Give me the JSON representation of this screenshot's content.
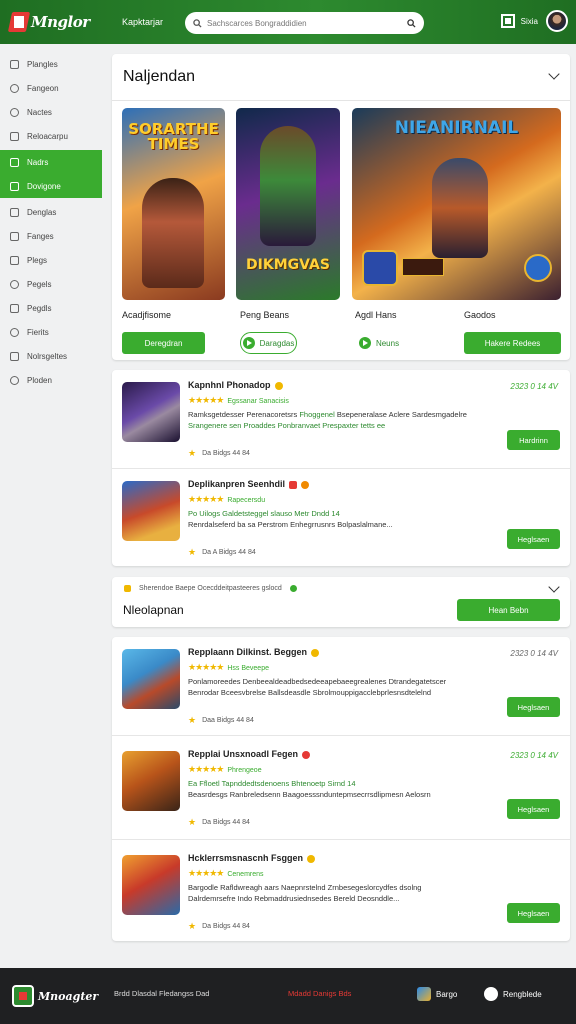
{
  "header": {
    "logo": "Mnglor",
    "nav_link": "Kapktarjar",
    "search_placeholder": "Sachscarces Bongraddidien",
    "user_name": "Sixia"
  },
  "sidebar": {
    "items": [
      {
        "label": "Plangles",
        "icon": "grid-icon"
      },
      {
        "label": "Fangeon",
        "icon": "gamepad-icon"
      },
      {
        "label": "Nactes",
        "icon": "clock-icon"
      },
      {
        "label": "Reloacarpu",
        "icon": "download-icon"
      },
      {
        "label": "Nadrs",
        "icon": "fire-icon",
        "active": true
      },
      {
        "label": "Dovigone",
        "icon": "star-icon",
        "active": true
      },
      {
        "label": "Denglas",
        "icon": "copy-icon"
      },
      {
        "label": "Fanges",
        "icon": "gift-icon"
      },
      {
        "label": "Plegs",
        "icon": "chart-icon"
      },
      {
        "label": "Pegels",
        "icon": "wrench-icon"
      },
      {
        "label": "Pegdls",
        "icon": "document-icon"
      },
      {
        "label": "Fierits",
        "icon": "tools-icon"
      },
      {
        "label": "Nolrsgeltes",
        "icon": "mail-icon"
      },
      {
        "label": "Ploden",
        "icon": "settings-icon"
      }
    ]
  },
  "hero": {
    "title": "Naljendan",
    "games": [
      {
        "poster_title": "SORARTHE TIMES",
        "name": "Acadjfisome",
        "button": "Deregdran",
        "style": "solid"
      },
      {
        "poster_title": "DIKMGVAS",
        "name": "Peng Beans",
        "button": "Daragdas",
        "style": "outline"
      },
      {
        "poster_title": "NIEANIRNAIL",
        "name": "Agdl Hans",
        "button": "Neuns",
        "style": "plain"
      },
      {
        "poster_title": "",
        "name": "Gaodos",
        "button": "Hakere Redees",
        "style": "solid"
      }
    ]
  },
  "list1": {
    "rows": [
      {
        "title": "Kapnhnl Phonadop",
        "date": "2323 0 14 4V",
        "rating": "★★★★★",
        "rating_count": "Egssanar Sanacisis",
        "desc1": "Ramksgetdesser Perenacoretsrs",
        "desc1_green": "Fhoggenel",
        "desc1_tail": "Bsepeneralase Aclere Sardesmgadelre",
        "desc2": "Srangenere sen Proaddes Ponbranvaet Prespaxter tetts ee",
        "meta": "Da  Bidgs   44  84",
        "button": "Hardrinn"
      },
      {
        "title": "Deplikanpren Seenhdil",
        "date": "",
        "rating": "★★★★★",
        "rating_count": "Rapecersdu",
        "desc1": "Po Uilogs Galdetsteggel slauso Metr Dndd 14",
        "desc1_green": "",
        "desc1_tail": "",
        "desc2": "Renrdalseferd ba sa Perstrom Enhegrrusnrs Bolpaslalmane...",
        "meta": "Da  A  Bidgs   44  84",
        "button": "Heglsaen"
      }
    ]
  },
  "banner": {
    "top_text": "Sherendoe   Baepe Ocecddeitpasteeres gslocd",
    "title": "Nleolapnan",
    "button": "Hean Bebn"
  },
  "list2": {
    "rows": [
      {
        "title": "Repplaann Dilkinst. Beggen",
        "date": "2323 0 14 4V",
        "rating": "★★★★★",
        "rating_count": "Hss Beveepe",
        "desc1": "Ponlamoreedes Denbeealdeadbedsedeeapebaeegrealenes Dtrandegatetscer",
        "desc1_green": "",
        "desc1_tail": "",
        "desc2": "Benrodar Bceesvbrelse Ballsdeasdle Sbrolmouppigacclebprlesnsdtelelnd",
        "meta": "Daa  Bidgs   44  84",
        "button": "Heglsaen"
      },
      {
        "title": "Repplai Unsxnoadl Fegen",
        "date": "2323 0 14 4V",
        "rating": "★★★★★",
        "rating_count": "Phrengeoe",
        "desc1": "Ea Ffloetl Tapnddedtsdenoens Bhtenoetp Sirnd 14",
        "desc1_green": "",
        "desc1_tail": "",
        "desc2": "Beasrdesgs Ranbreledsenn Baagoesssnduntepmsecrrsdlipmesn Aelosrn",
        "meta": "Da  Bidgs   44  84",
        "button": "Heglsaen"
      },
      {
        "title": "Hcklerrsmsnascnh Fsggen",
        "date": "",
        "rating": "★★★★★",
        "rating_count": "Cenemrens",
        "desc1": "Bargodle Rafldwreagh aars Naepnrstelnd Zrnbesegeslorcydfes dsolng",
        "desc1_green": "",
        "desc1_tail": "",
        "desc2": "Dalrdemrsefre Indo Rebmaddrusiednsedes Bereld Deosnddle...",
        "meta": "Da  Bidgs   44  84",
        "button": "Heglsaen"
      }
    ]
  },
  "footer": {
    "logo": "Mnoagter",
    "link1": "Brdd Dlasdal Fledangss Dad",
    "link2": "Mdadd Danigs Bds",
    "app1": "Bargo",
    "app2": "Rengblede"
  },
  "colors": {
    "brand_green": "#3aac2f",
    "header_green": "#2d8a2f",
    "star_gold": "#f0b800",
    "footer_dark": "#1f2022"
  }
}
